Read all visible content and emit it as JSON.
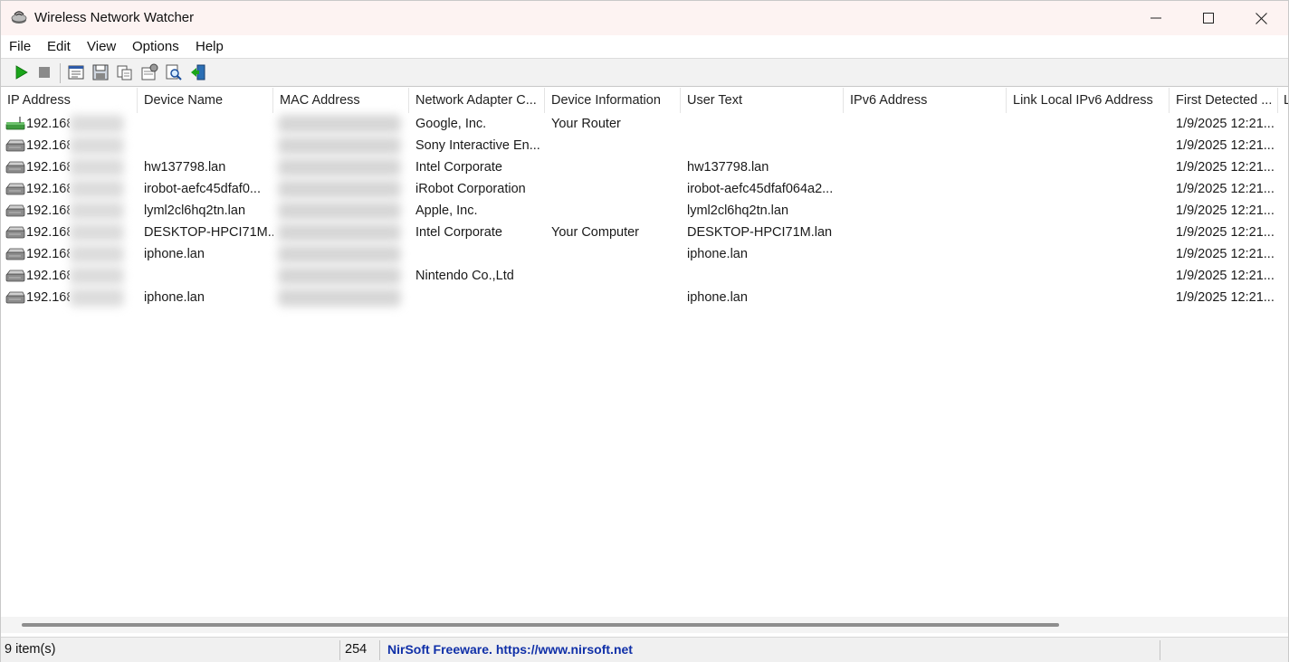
{
  "window": {
    "title": "Wireless Network Watcher"
  },
  "menu": [
    "File",
    "Edit",
    "View",
    "Options",
    "Help"
  ],
  "toolbar": {
    "icons": [
      "play-icon",
      "stop-icon",
      "html-report-icon",
      "save-icon",
      "copy-icon",
      "properties-icon",
      "find-icon",
      "exit-icon"
    ]
  },
  "columns": [
    "IP Address",
    "Device Name",
    "MAC Address",
    "Network Adapter C...",
    "Device Information",
    "User Text",
    "IPv6 Address",
    "Link Local IPv6 Address",
    "First Detected ...",
    "L"
  ],
  "rows": [
    {
      "ip": "192.168",
      "device": "",
      "adapter": "Google, Inc.",
      "info": "Your Router",
      "user_text": "",
      "first_detected": "1/9/2025 12:21...",
      "icon": "router-icon"
    },
    {
      "ip": "192.168",
      "device": "",
      "adapter": "Sony Interactive En...",
      "info": "",
      "user_text": "",
      "first_detected": "1/9/2025 12:21...",
      "icon": "device-icon"
    },
    {
      "ip": "192.168",
      "device": "hw137798.lan",
      "adapter": "Intel Corporate",
      "info": "",
      "user_text": "hw137798.lan",
      "first_detected": "1/9/2025 12:21...",
      "icon": "device-icon"
    },
    {
      "ip": "192.168",
      "device": "irobot-aefc45dfaf0...",
      "adapter": "iRobot Corporation",
      "info": "",
      "user_text": "irobot-aefc45dfaf064a2...",
      "first_detected": "1/9/2025 12:21...",
      "icon": "device-icon"
    },
    {
      "ip": "192.168",
      "device": "lyml2cl6hq2tn.lan",
      "adapter": "Apple, Inc.",
      "info": "",
      "user_text": "lyml2cl6hq2tn.lan",
      "first_detected": "1/9/2025 12:21...",
      "icon": "device-icon"
    },
    {
      "ip": "192.168",
      "device": "DESKTOP-HPCI71M...",
      "adapter": "Intel Corporate",
      "info": "Your Computer",
      "user_text": "DESKTOP-HPCI71M.lan",
      "first_detected": "1/9/2025 12:21...",
      "icon": "device-icon"
    },
    {
      "ip": "192.168",
      "device": "iphone.lan",
      "adapter": "",
      "info": "",
      "user_text": "iphone.lan",
      "first_detected": "1/9/2025 12:21...",
      "icon": "device-icon"
    },
    {
      "ip": "192.168",
      "device": "",
      "adapter": "Nintendo Co.,Ltd",
      "info": "",
      "user_text": "",
      "first_detected": "1/9/2025 12:21...",
      "icon": "device-icon"
    },
    {
      "ip": "192.168",
      "device": "iphone.lan",
      "adapter": "",
      "info": "",
      "user_text": "iphone.lan",
      "first_detected": "1/9/2025 12:21...",
      "icon": "device-icon"
    }
  ],
  "status": {
    "items": "9 item(s)",
    "count": "254",
    "link": "NirSoft Freeware. https://www.nirsoft.net"
  }
}
